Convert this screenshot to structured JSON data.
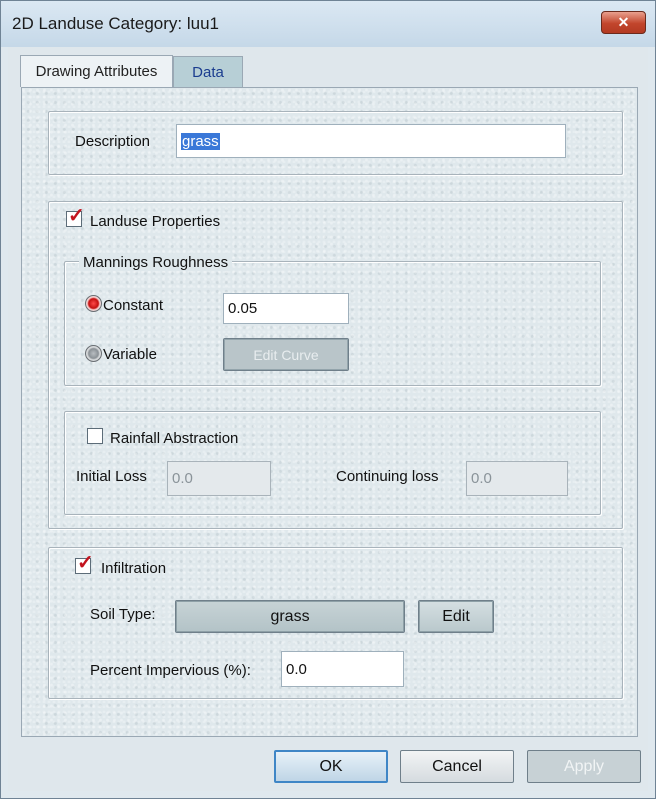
{
  "window": {
    "title": "2D Landuse Category: luu1"
  },
  "tabs": [
    {
      "label": "Drawing Attributes",
      "active": false
    },
    {
      "label": "Data",
      "active": true
    }
  ],
  "description": {
    "label": "Description",
    "value": "grass"
  },
  "landuse_properties": {
    "label": "Landuse Properties",
    "checked": true,
    "mannings": {
      "title": "Mannings Roughness",
      "constant_label": "Constant",
      "constant_value": "0.05",
      "variable_label": "Variable",
      "edit_curve_label": "Edit Curve",
      "selected": "Constant"
    },
    "rainfall": {
      "label": "Rainfall Abstraction",
      "checked": false,
      "initial_loss_label": "Initial Loss",
      "initial_loss_value": "0.0",
      "continuing_loss_label": "Continuing loss",
      "continuing_loss_value": "0.0"
    }
  },
  "infiltration": {
    "label": "Infiltration",
    "checked": true,
    "soil_type_label": "Soil Type:",
    "soil_type_value": "grass",
    "edit_label": "Edit",
    "percent_impervious_label": "Percent Impervious (%):",
    "percent_impervious_value": "0.0"
  },
  "footer": {
    "ok_label": "OK",
    "cancel_label": "Cancel",
    "apply_label": "Apply"
  },
  "colors": {
    "title_bar": "#c5d8e8",
    "close_button": "#c2452c",
    "check_mark": "#c3141e",
    "selection": "#3a78d8"
  },
  "icons": {
    "close": "close-icon",
    "check": "check-mark-icon"
  }
}
